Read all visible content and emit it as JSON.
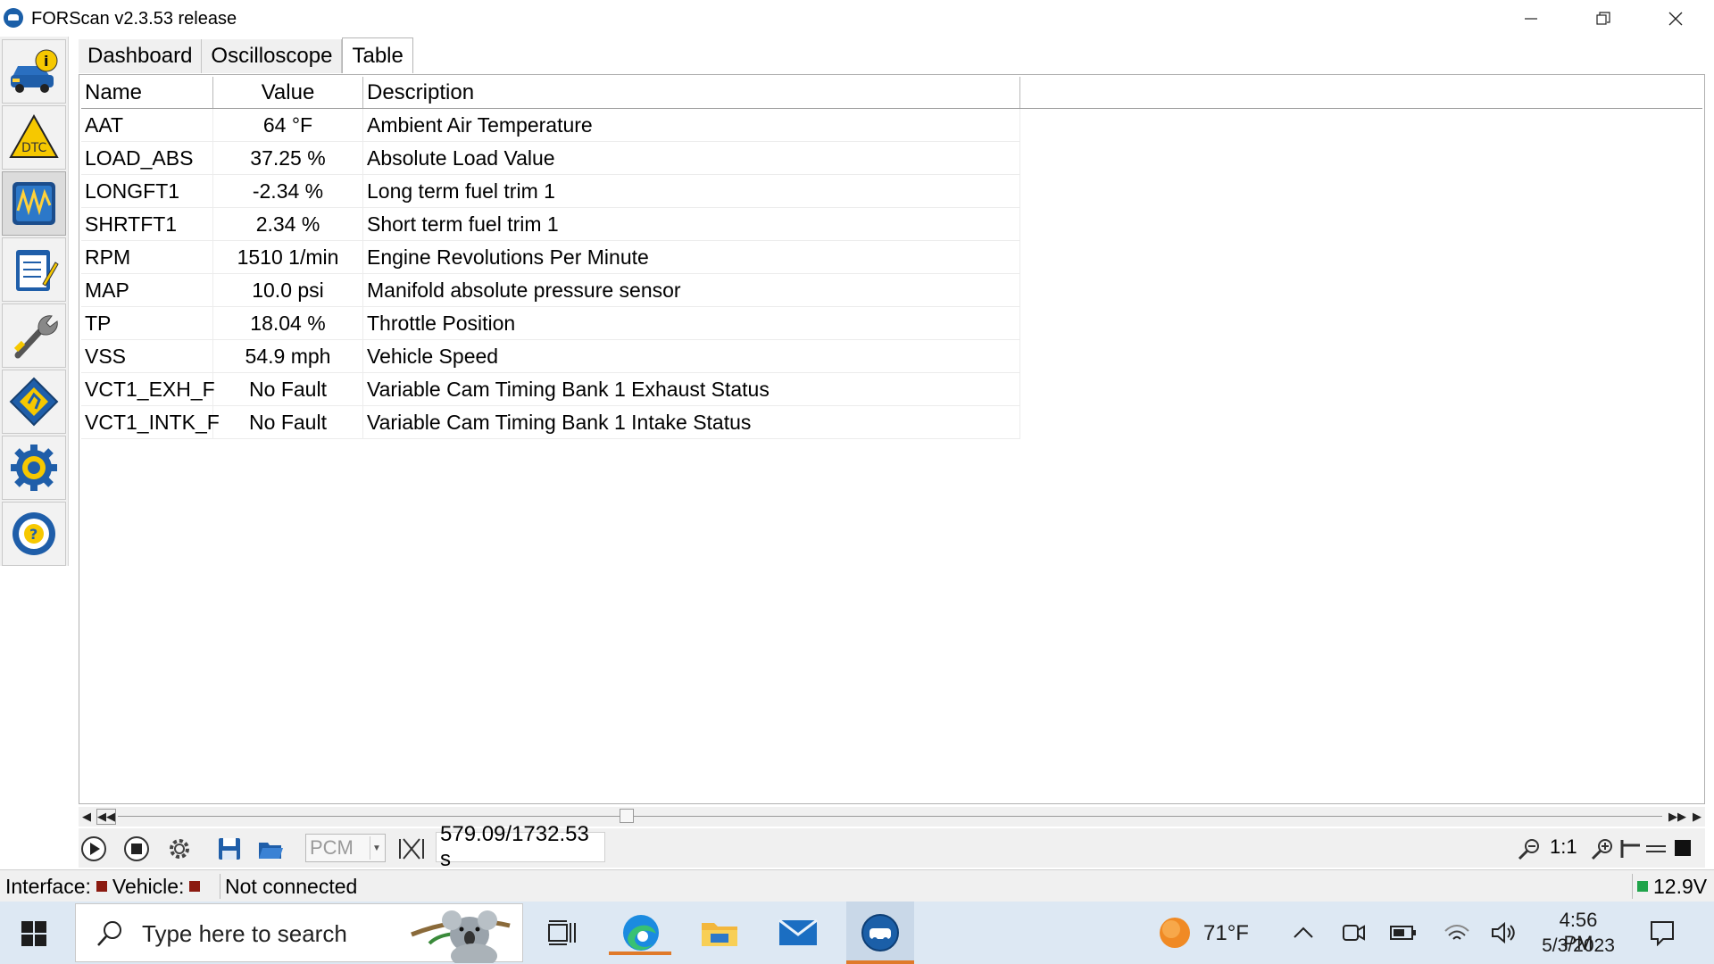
{
  "window": {
    "title": "FORScan v2.3.53 release"
  },
  "sidebar": {
    "items": [
      {
        "name": "vehicle-info"
      },
      {
        "name": "dtc"
      },
      {
        "name": "oscilloscope",
        "active": true
      },
      {
        "name": "tests"
      },
      {
        "name": "service"
      },
      {
        "name": "modules"
      },
      {
        "name": "settings"
      },
      {
        "name": "help"
      }
    ]
  },
  "tabs": [
    {
      "label": "Dashboard"
    },
    {
      "label": "Oscilloscope"
    },
    {
      "label": "Table",
      "active": true
    }
  ],
  "table": {
    "headers": [
      "Name",
      "Value",
      "Description"
    ],
    "rows": [
      {
        "name": "AAT",
        "value": "64 °F",
        "description": "Ambient Air Temperature"
      },
      {
        "name": "LOAD_ABS",
        "value": "37.25 %",
        "description": "Absolute Load Value"
      },
      {
        "name": "LONGFT1",
        "value": "-2.34 %",
        "description": "Long term fuel trim 1"
      },
      {
        "name": "SHRTFT1",
        "value": "2.34 %",
        "description": "Short term fuel trim 1"
      },
      {
        "name": "RPM",
        "value": "1510 1/min",
        "description": "Engine Revolutions Per Minute"
      },
      {
        "name": "MAP",
        "value": "10.0 psi",
        "description": "Manifold absolute pressure sensor"
      },
      {
        "name": "TP",
        "value": "18.04 %",
        "description": "Throttle Position"
      },
      {
        "name": "VSS",
        "value": "54.9 mph",
        "description": "Vehicle Speed"
      },
      {
        "name": "VCT1_EXH_F",
        "value": "No Fault",
        "description": "Variable Cam Timing Bank 1 Exhaust Status"
      },
      {
        "name": "VCT1_INTK_F",
        "value": "No Fault",
        "description": "Variable Cam Timing Bank 1 Intake Status"
      }
    ]
  },
  "toolbar": {
    "module_select": "PCM",
    "time_position": "579.09/1732.53 s",
    "zoom_ratio": "1:1"
  },
  "status": {
    "interface_label": "Interface:",
    "vehicle_label": "Vehicle:",
    "connection_text": "Not connected",
    "voltage": "12.9V",
    "interface_color": "#8b1a10",
    "vehicle_color": "#8b1a10",
    "voltage_color": "#1fa34a"
  },
  "taskbar": {
    "search_placeholder": "Type here to search",
    "weather": "71°F",
    "time": "4:56 PM",
    "date": "5/3/2023"
  }
}
